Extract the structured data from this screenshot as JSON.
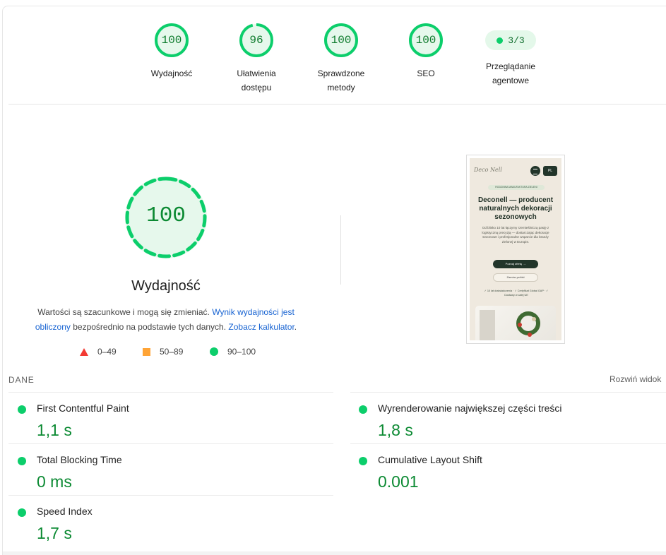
{
  "colors": {
    "pass": "#0cce6b",
    "pass_text": "#0c8a33",
    "average": "#ffa436",
    "fail": "#f33a33",
    "link": "#1763d2"
  },
  "categories": [
    {
      "score": "100",
      "label": "Wydajność",
      "fraction": 1.0
    },
    {
      "score": "96",
      "label": "Ułatwienia dostępu",
      "fraction": 0.96
    },
    {
      "score": "100",
      "label": "Sprawdzone metody",
      "fraction": 1.0
    },
    {
      "score": "100",
      "label": "SEO",
      "fraction": 1.0
    }
  ],
  "agent": {
    "value": "3/3",
    "label": "Przeglądanie agentowe"
  },
  "performance": {
    "score": "100",
    "title": "Wydajność",
    "desc_part1": "Wartości są szacunkowe i mogą się zmieniać. ",
    "desc_link1": "Wynik wydajności jest obliczony",
    "desc_part2": " bezpośrednio na podstawie tych danych. ",
    "desc_link2": "Zobacz kalkulator",
    "desc_part3": "."
  },
  "legend": [
    {
      "icon": "triangle-fail-icon",
      "range": "0–49"
    },
    {
      "icon": "square-average-icon",
      "range": "50–89"
    },
    {
      "icon": "circle-pass-icon",
      "range": "90–100"
    }
  ],
  "thumbnail": {
    "logo": "Deco Nell",
    "lang": "PL",
    "badge": "RODZINNA MANUFAKTURA ZIELENI",
    "heading": "Deconell — producent naturalnych dekoracji sezonowych",
    "paragraph": "Od blisko 10 lat łączymy rzemieślniczą pasję z logistyczną precyzją — dostarczając dekoracje sezonowe i profesjonalne wsparcie dla branży zielonej w Europie.",
    "button_primary": "Poznaj ofertę →",
    "button_secondary": "Zamów próbki",
    "checks": "✓ 10 lat doświadczenia · ✓ Certyfikat Global GAP · ✓ Dostawy w całej UE"
  },
  "data_section": {
    "label": "DANE",
    "expand": "Rozwiń widok"
  },
  "metrics": [
    {
      "name": "First Contentful Paint",
      "value": "1,1 s"
    },
    {
      "name": "Wyrenderowanie największej części treści",
      "value": "1,8 s"
    },
    {
      "name": "Total Blocking Time",
      "value": "0 ms"
    },
    {
      "name": "Cumulative Layout Shift",
      "value": "0.001"
    },
    {
      "name": "Speed Index",
      "value": "1,7 s"
    }
  ]
}
